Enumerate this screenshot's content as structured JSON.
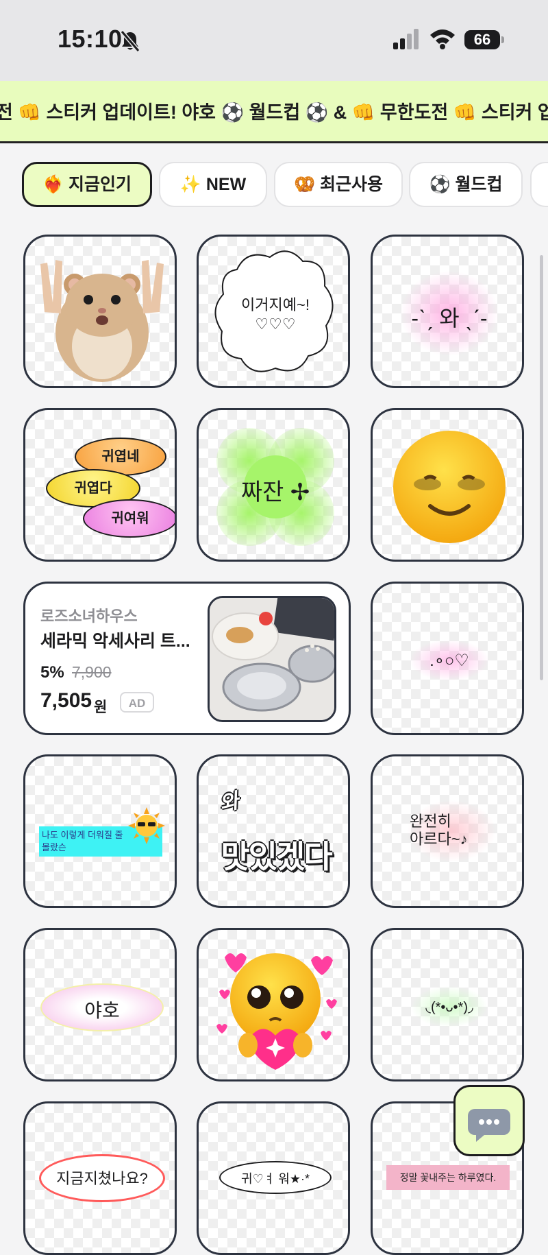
{
  "status_bar": {
    "time": "15:10",
    "battery": "66"
  },
  "ticker": {
    "text": "전 👊 스티커 업데이트! 야호   ⚽ 월드컵 ⚽ & 👊 무한도전 👊 스티커 업데이트! 야호"
  },
  "tabs": [
    {
      "icon": "❤️‍🔥",
      "label": "지금인기"
    },
    {
      "icon": "✨",
      "label": "NEW"
    },
    {
      "icon": "🥨",
      "label": "최근사용"
    },
    {
      "icon": "⚽",
      "label": "월드컵"
    }
  ],
  "stickers": {
    "cloud": "이거지예~!\n♡♡♡",
    "wa": "-ˋˏ 와 ˎˊ-",
    "pills": [
      "귀엽네",
      "귀엽다",
      "귀여워"
    ],
    "jjajan": "짜잔 ✢",
    "heart_dots": ".∘○♡",
    "sun_text": "나도 이렇게 더워질 줄\n몰랐슨",
    "wa2": "와",
    "masitgetda": "맛있겠다",
    "wanjeonhi": "완전히\n아르다~♪",
    "yaho": "야호",
    "kaomoji": "◟(*•ᴗ•*)◞",
    "tired": "지금지쳤나요?",
    "gwiyeowo": "귀♡ㅕ 워★·*",
    "pretty_day": "정말 꽃내주는 하루였다."
  },
  "ad": {
    "store": "로즈소녀하우스",
    "title": "세라믹 악세사리 트...",
    "discount": "5%",
    "original_price": "7,900",
    "price": "7,505",
    "currency": "원",
    "badge": "AD"
  },
  "colors": {
    "accent": "#ecfcc3",
    "border": "#2d3340",
    "ticker_bg": "#e8fcbd"
  }
}
